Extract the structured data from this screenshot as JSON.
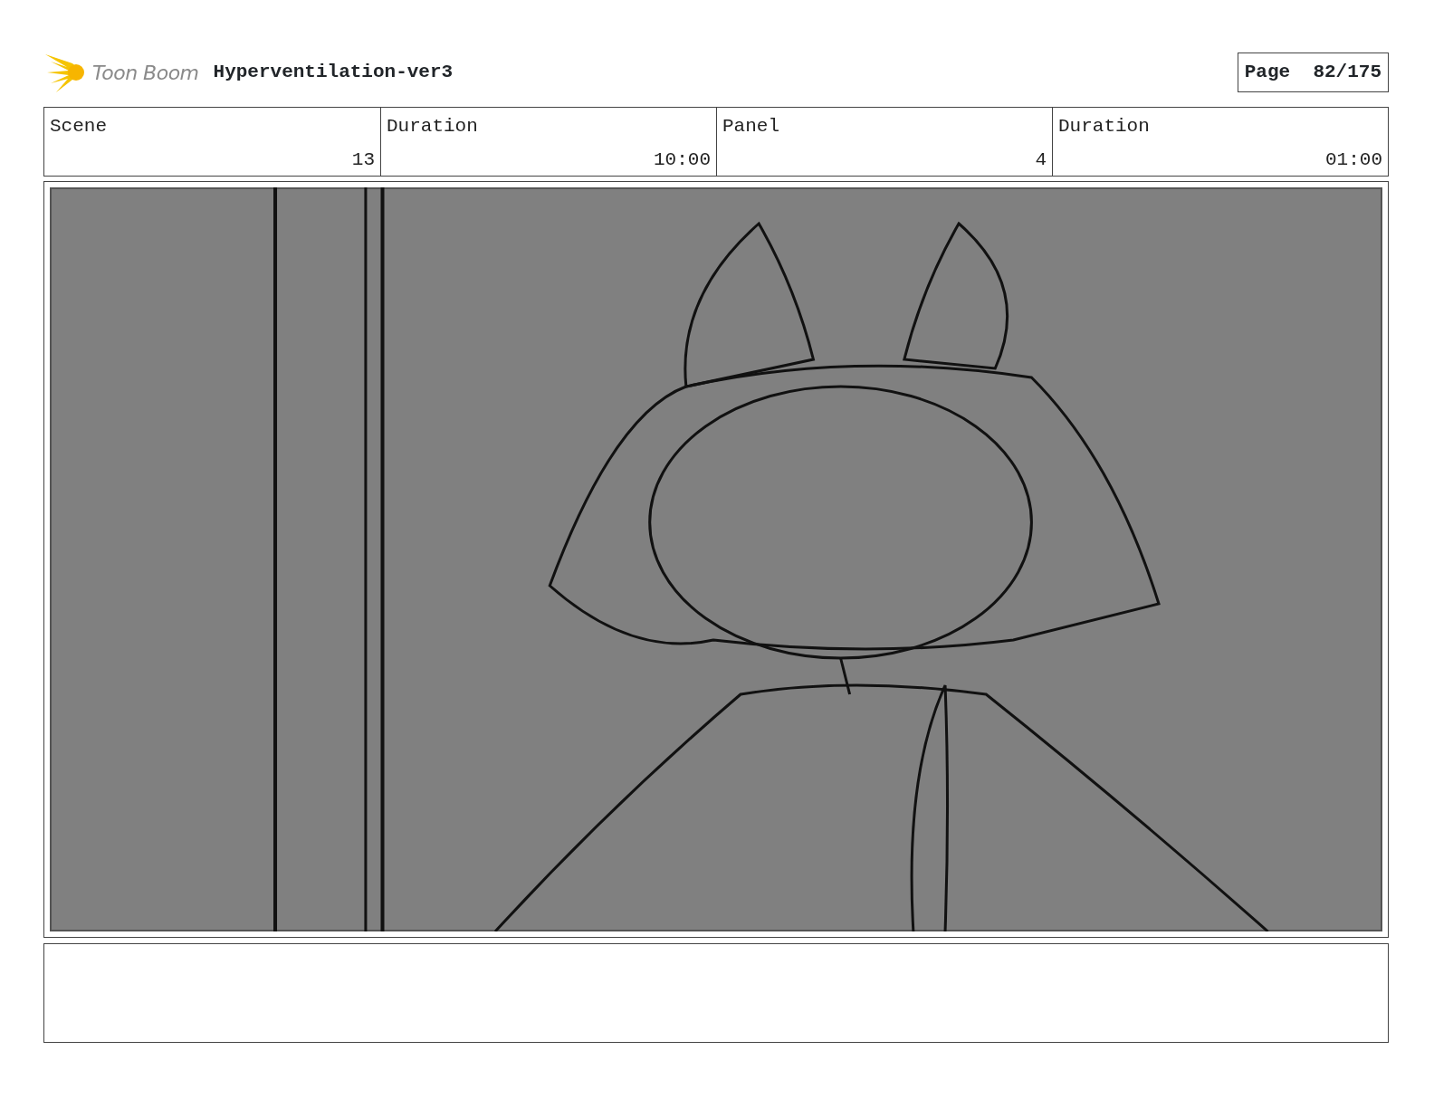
{
  "header": {
    "logo_text": "Toon Boom",
    "title": "Hyperventilation-ver3",
    "page_label": "Page",
    "page_number": "82/175"
  },
  "info_table": {
    "columns": [
      "Scene",
      "Duration",
      "Panel",
      "Duration"
    ],
    "values": [
      "13",
      "10:00",
      "4",
      "01:00"
    ]
  }
}
